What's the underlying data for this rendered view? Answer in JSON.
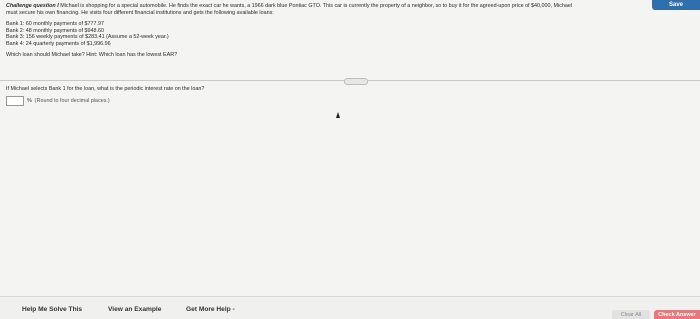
{
  "toolbar": {
    "save_label": "Save"
  },
  "problem": {
    "heading": "Challenge question I",
    "text_line1": " Michael is shopping for a special automobile. He finds the exact car he wants, a 1966 dark blue Pontiac GTO. This car is currently the property of a neighbor, so to buy it for the agreed-upon price of $40,000, Michael",
    "text_line2": "must secure his own financing. He visits four different financial institutions and gets the following available loans:",
    "banks": [
      "Bank 1: 60 monthly payments of $777.97",
      "Bank 2: 48 monthly payments of $948.60",
      "Bank 3: 156 weekly payments of $283.41 (Assume a 52-week year.)",
      "Bank 4: 24 quarterly payments of $1,996.96"
    ],
    "question": "Which loan should Michael take? Hint: Which loan has the lowest EAR?"
  },
  "sub_question": "If Michael selects Bank 1 for the loan, what is the periodic interest rate on the loan?",
  "answer": {
    "unit": "%",
    "hint": "(Round to four decimal places.)"
  },
  "footer": {
    "help_label": "Help Me Solve This",
    "example_label": "View an Example",
    "more_help_label": "Get More Help -",
    "clear_all_label": "Clear All",
    "check_answer_label": "Check Answer"
  }
}
